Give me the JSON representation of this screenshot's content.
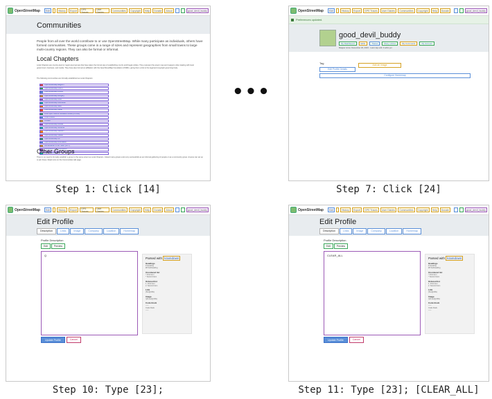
{
  "captions": {
    "step1": "Step 1: Click [14]",
    "step7": "Step 7: Click [24]",
    "step10": "Step 10: Type [23];",
    "step11": "Step 11: Type [23]; [CLEAR_ALL]"
  },
  "ellipsis": "•••",
  "osm": {
    "brand": "OpenStreetMap",
    "nav": [
      "Edit",
      "",
      "History",
      "Export",
      "GPS Traces",
      "User Diaries",
      "Communities",
      "Copyright",
      "Help",
      "Donate",
      "About"
    ],
    "user_label": "good_devil_buddy"
  },
  "communities": {
    "title": "Communities",
    "intro": "People from all over the world contribute to or use OpenStreetMap. While many participate as individuals, others have formed communities. These groups come in a range of sizes and represent geographies from small towns to large multi-country regions. They can also be formal or informal.",
    "local_heading": "Local Chapters",
    "local_text": "Local Chapters are country-level or region-level groups that have taken the formal step of establishing not-for-profit legal entities. They represent the area's map and mappers when dealing with local government, business, and media. They have also formed an affiliation with the OpenStreetMap Foundation (OSMF), giving them a link to the legal and copyright governing body.",
    "list_intro": "The following communities are formally established as Local Chapters:",
    "chapters": [
      "OpenStreetMap Belgium",
      "OpenStreetMap Czech",
      "OpenStreetMap France",
      "OpenStreetMap Hungary",
      "OpenStreetMap India",
      "OpenStreetMap Indonesia",
      "OpenStreetMap Italia",
      "OpenStreetMap Japan",
      "Free Open Source Software Korea (FOSSK)",
      "OSM Poland",
      "OSGeo",
      "OpenStreetMap Russia",
      "OpenStreetMap Slovenia",
      "OpenStreetMap Sweden",
      "OpenStreetMap Taiwan",
      "OpenStreetMap UK",
      "OpenStreetMap Foundation",
      "Humanitarian OSM Team (HOT)",
      "Geospatial OSM Foundation",
      "OpenStreetMap US"
    ],
    "other_heading": "Other Groups",
    "other_text": "There is no need to formally establish a group to the same extent as Local Chapters. Indeed many groups exist very successfully as an informal gathering of people or as a community group. Anyone can set up or join these. Read more on the Communities wiki page."
  },
  "profile": {
    "prefs_notice": "Preferences updated.",
    "username": "good_devil_buddy",
    "chips": [
      "My Dashboard",
      "Edits",
      "Traces",
      "Diary entries",
      "My Comments",
      "My Account"
    ],
    "mapper_since": "Mapper since: December 20, 2023 · Last map edit: 0 edits yet",
    "tag_label": "Tag",
    "edit_profile_button": "Edit Profile Details",
    "add_image_button": "Add an image",
    "configure_button": "Configure Homemap"
  },
  "edit": {
    "title": "Edit Profile",
    "tabs": [
      "Description",
      "Links",
      "Image",
      "Company",
      "Location",
      "Homemap"
    ],
    "desc_label": "Profile Description",
    "subtabs": [
      "Edit",
      "Preview"
    ],
    "editor_text_step10": "Q",
    "editor_text_step11": "CLEAR_ALL",
    "help_title_prefix": "Parsed with ",
    "help_title_link": "kramdown",
    "help_sections": [
      {
        "head": "Headings",
        "lines": [
          "# Heading",
          "## Subheading"
        ]
      },
      {
        "head": "Unordered list",
        "lines": [
          "* First item",
          "* Second item"
        ]
      },
      {
        "head": "Ordered list",
        "lines": [
          "1. First item",
          "2. Second item"
        ]
      },
      {
        "head": "Link",
        "lines": [
          "[Text](URL)"
        ]
      },
      {
        "head": "Image",
        "lines": [
          "![Alt text](URL)"
        ]
      },
      {
        "head": "Code block",
        "lines": [
          "~~~",
          "Code block",
          "~~~"
        ]
      }
    ],
    "update_button": "Update Profile",
    "cancel_button": "Cancel"
  }
}
